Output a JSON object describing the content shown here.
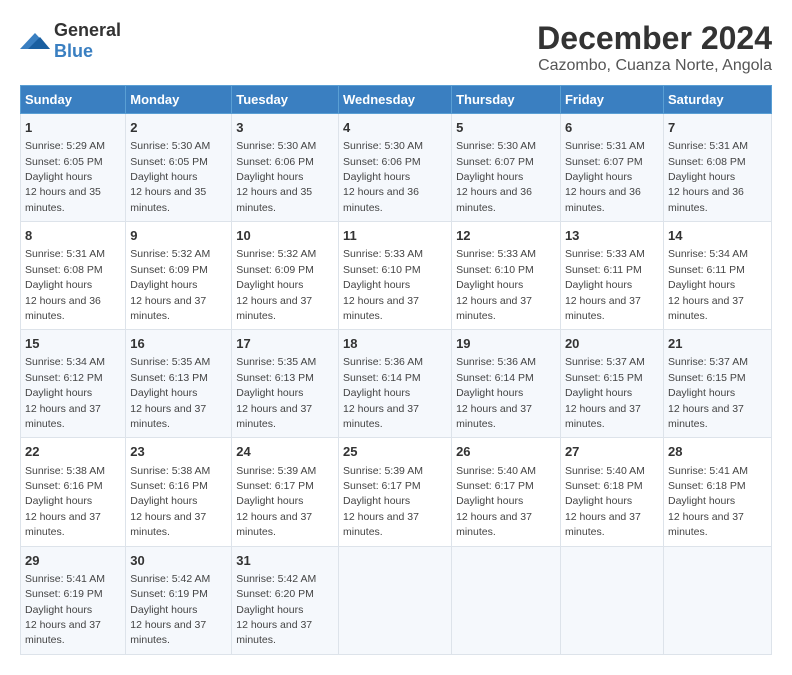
{
  "logo": {
    "general": "General",
    "blue": "Blue"
  },
  "title": "December 2024",
  "subtitle": "Cazombo, Cuanza Norte, Angola",
  "days_of_week": [
    "Sunday",
    "Monday",
    "Tuesday",
    "Wednesday",
    "Thursday",
    "Friday",
    "Saturday"
  ],
  "weeks": [
    [
      {
        "day": "1",
        "sunrise": "5:29 AM",
        "sunset": "6:05 PM",
        "daylight": "12 hours and 35 minutes."
      },
      {
        "day": "2",
        "sunrise": "5:30 AM",
        "sunset": "6:05 PM",
        "daylight": "12 hours and 35 minutes."
      },
      {
        "day": "3",
        "sunrise": "5:30 AM",
        "sunset": "6:06 PM",
        "daylight": "12 hours and 35 minutes."
      },
      {
        "day": "4",
        "sunrise": "5:30 AM",
        "sunset": "6:06 PM",
        "daylight": "12 hours and 36 minutes."
      },
      {
        "day": "5",
        "sunrise": "5:30 AM",
        "sunset": "6:07 PM",
        "daylight": "12 hours and 36 minutes."
      },
      {
        "day": "6",
        "sunrise": "5:31 AM",
        "sunset": "6:07 PM",
        "daylight": "12 hours and 36 minutes."
      },
      {
        "day": "7",
        "sunrise": "5:31 AM",
        "sunset": "6:08 PM",
        "daylight": "12 hours and 36 minutes."
      }
    ],
    [
      {
        "day": "8",
        "sunrise": "5:31 AM",
        "sunset": "6:08 PM",
        "daylight": "12 hours and 36 minutes."
      },
      {
        "day": "9",
        "sunrise": "5:32 AM",
        "sunset": "6:09 PM",
        "daylight": "12 hours and 37 minutes."
      },
      {
        "day": "10",
        "sunrise": "5:32 AM",
        "sunset": "6:09 PM",
        "daylight": "12 hours and 37 minutes."
      },
      {
        "day": "11",
        "sunrise": "5:33 AM",
        "sunset": "6:10 PM",
        "daylight": "12 hours and 37 minutes."
      },
      {
        "day": "12",
        "sunrise": "5:33 AM",
        "sunset": "6:10 PM",
        "daylight": "12 hours and 37 minutes."
      },
      {
        "day": "13",
        "sunrise": "5:33 AM",
        "sunset": "6:11 PM",
        "daylight": "12 hours and 37 minutes."
      },
      {
        "day": "14",
        "sunrise": "5:34 AM",
        "sunset": "6:11 PM",
        "daylight": "12 hours and 37 minutes."
      }
    ],
    [
      {
        "day": "15",
        "sunrise": "5:34 AM",
        "sunset": "6:12 PM",
        "daylight": "12 hours and 37 minutes."
      },
      {
        "day": "16",
        "sunrise": "5:35 AM",
        "sunset": "6:13 PM",
        "daylight": "12 hours and 37 minutes."
      },
      {
        "day": "17",
        "sunrise": "5:35 AM",
        "sunset": "6:13 PM",
        "daylight": "12 hours and 37 minutes."
      },
      {
        "day": "18",
        "sunrise": "5:36 AM",
        "sunset": "6:14 PM",
        "daylight": "12 hours and 37 minutes."
      },
      {
        "day": "19",
        "sunrise": "5:36 AM",
        "sunset": "6:14 PM",
        "daylight": "12 hours and 37 minutes."
      },
      {
        "day": "20",
        "sunrise": "5:37 AM",
        "sunset": "6:15 PM",
        "daylight": "12 hours and 37 minutes."
      },
      {
        "day": "21",
        "sunrise": "5:37 AM",
        "sunset": "6:15 PM",
        "daylight": "12 hours and 37 minutes."
      }
    ],
    [
      {
        "day": "22",
        "sunrise": "5:38 AM",
        "sunset": "6:16 PM",
        "daylight": "12 hours and 37 minutes."
      },
      {
        "day": "23",
        "sunrise": "5:38 AM",
        "sunset": "6:16 PM",
        "daylight": "12 hours and 37 minutes."
      },
      {
        "day": "24",
        "sunrise": "5:39 AM",
        "sunset": "6:17 PM",
        "daylight": "12 hours and 37 minutes."
      },
      {
        "day": "25",
        "sunrise": "5:39 AM",
        "sunset": "6:17 PM",
        "daylight": "12 hours and 37 minutes."
      },
      {
        "day": "26",
        "sunrise": "5:40 AM",
        "sunset": "6:17 PM",
        "daylight": "12 hours and 37 minutes."
      },
      {
        "day": "27",
        "sunrise": "5:40 AM",
        "sunset": "6:18 PM",
        "daylight": "12 hours and 37 minutes."
      },
      {
        "day": "28",
        "sunrise": "5:41 AM",
        "sunset": "6:18 PM",
        "daylight": "12 hours and 37 minutes."
      }
    ],
    [
      {
        "day": "29",
        "sunrise": "5:41 AM",
        "sunset": "6:19 PM",
        "daylight": "12 hours and 37 minutes."
      },
      {
        "day": "30",
        "sunrise": "5:42 AM",
        "sunset": "6:19 PM",
        "daylight": "12 hours and 37 minutes."
      },
      {
        "day": "31",
        "sunrise": "5:42 AM",
        "sunset": "6:20 PM",
        "daylight": "12 hours and 37 minutes."
      },
      null,
      null,
      null,
      null
    ]
  ]
}
